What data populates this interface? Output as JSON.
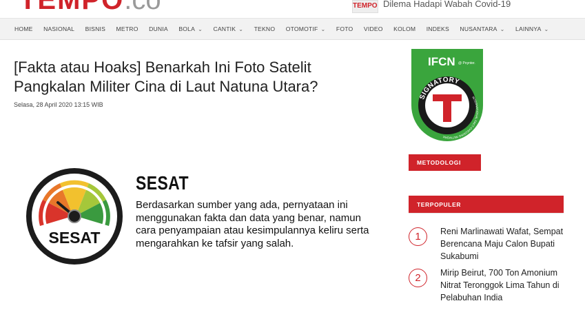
{
  "header": {
    "logo_main": "TEMPO",
    "logo_suffix": ".co",
    "ticker_thumb_text": "TEMPO.CO",
    "ticker_text": "Dilema Hadapi Wabah Covid-19"
  },
  "nav": {
    "items": [
      {
        "label": "HOME",
        "dropdown": false
      },
      {
        "label": "NASIONAL",
        "dropdown": false
      },
      {
        "label": "BISNIS",
        "dropdown": false
      },
      {
        "label": "METRO",
        "dropdown": false
      },
      {
        "label": "DUNIA",
        "dropdown": false
      },
      {
        "label": "BOLA",
        "dropdown": true
      },
      {
        "label": "CANTIK",
        "dropdown": true
      },
      {
        "label": "TEKNO",
        "dropdown": false
      },
      {
        "label": "OTOMOTIF",
        "dropdown": true
      },
      {
        "label": "FOTO",
        "dropdown": false
      },
      {
        "label": "VIDEO",
        "dropdown": false
      },
      {
        "label": "KOLOM",
        "dropdown": false
      },
      {
        "label": "INDEKS",
        "dropdown": false
      },
      {
        "label": "NUSANTARA",
        "dropdown": true
      },
      {
        "label": "LAINNYA",
        "dropdown": true
      }
    ]
  },
  "article": {
    "title": "[Fakta atau Hoaks] Benarkah Ini Foto Satelit Pangkalan Militer Cina di Laut Natuna Utara?",
    "date": "Selasa, 28 April 2020 13:15 WIB"
  },
  "verdict": {
    "gauge_label": "SESAT",
    "title": "SESAT",
    "description": "Berdasarkan sumber yang ada, pernyataan ini menggunakan fakta dan data yang benar, namun cara penyampaian atau kesimpulannya keliru serta mengarahkan ke tafsir yang salah.",
    "colors": {
      "red": "#d9342b",
      "orange": "#e8772a",
      "yellow": "#f2c12e",
      "lightgreen": "#a5c73a",
      "green": "#3a9a3f",
      "ring": "#1c1c1c"
    }
  },
  "sidebar": {
    "badge": {
      "ifcn": "IFCN",
      "poynter": "@ Poynter.",
      "signatory": "SIGNATORY",
      "letter": "T",
      "network": "INTERNATIONAL FACT-CHECKING NETWORK",
      "colors": {
        "green": "#3aa53d",
        "red": "#d0232a",
        "dark": "#1a1a1a"
      }
    },
    "metodologi_label": "METODOLOGI",
    "terpopuler_label": "TERPOPULER",
    "popular": [
      {
        "num": "1",
        "title": "Reni Marlinawati Wafat, Sempat Berencana Maju Calon Bupati Sukabumi"
      },
      {
        "num": "2",
        "title": "Mirip Beirut, 700 Ton Amonium Nitrat Teronggok Lima Tahun di Pelabuhan India"
      }
    ]
  }
}
